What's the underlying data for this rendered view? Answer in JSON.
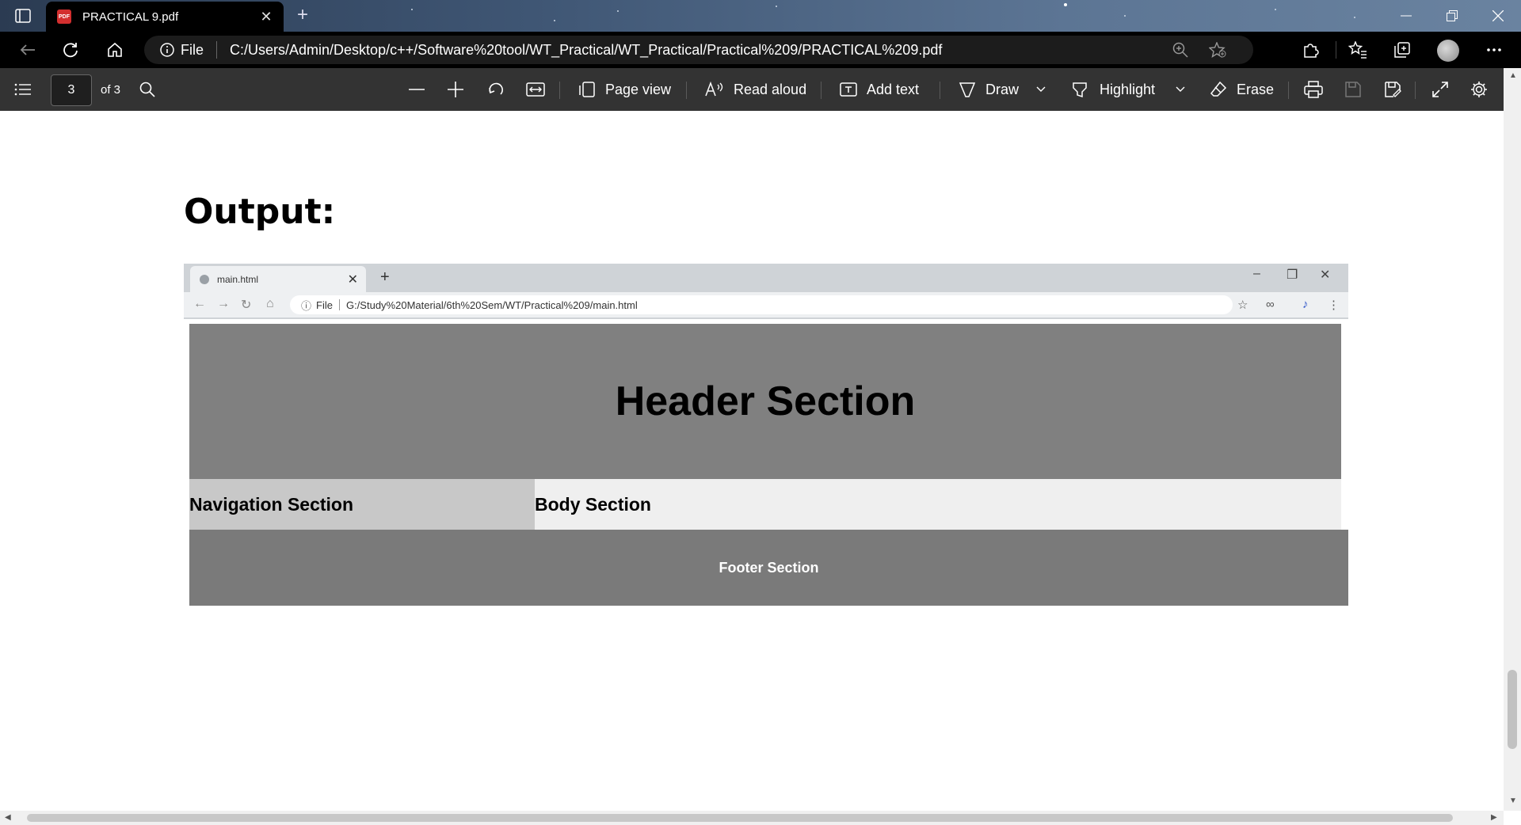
{
  "browser": {
    "tab_title": "PRACTICAL 9.pdf",
    "tab_icon": "pdf-icon",
    "address_prefix": "File",
    "url": "C:/Users/Admin/Desktop/c++/Software%20tool/WT_Practical/WT_Practical/Practical%209/PRACTICAL%209.pdf"
  },
  "pdf_toolbar": {
    "page_current": "3",
    "page_total": "of 3",
    "page_view": "Page view",
    "read_aloud": "Read aloud",
    "add_text": "Add text",
    "draw": "Draw",
    "highlight": "Highlight",
    "erase": "Erase"
  },
  "document": {
    "heading": "Output:",
    "screenshot": {
      "tab_title": "main.html",
      "address_prefix": "File",
      "url": "G:/Study%20Material/6th%20Sem/WT/Practical%209/main.html",
      "header_section": "Header Section",
      "navigation_section": "Navigation Section",
      "body_section": "Body Section",
      "footer_section": "Footer Section"
    }
  },
  "colors": {
    "pdf_toolbar_bg": "#333333",
    "address_bar_bg": "#000000",
    "header_gray": "#808080",
    "footer_gray": "#7a7a7a",
    "nav_gray": "#c8c8c8",
    "body_gray": "#efefef"
  }
}
